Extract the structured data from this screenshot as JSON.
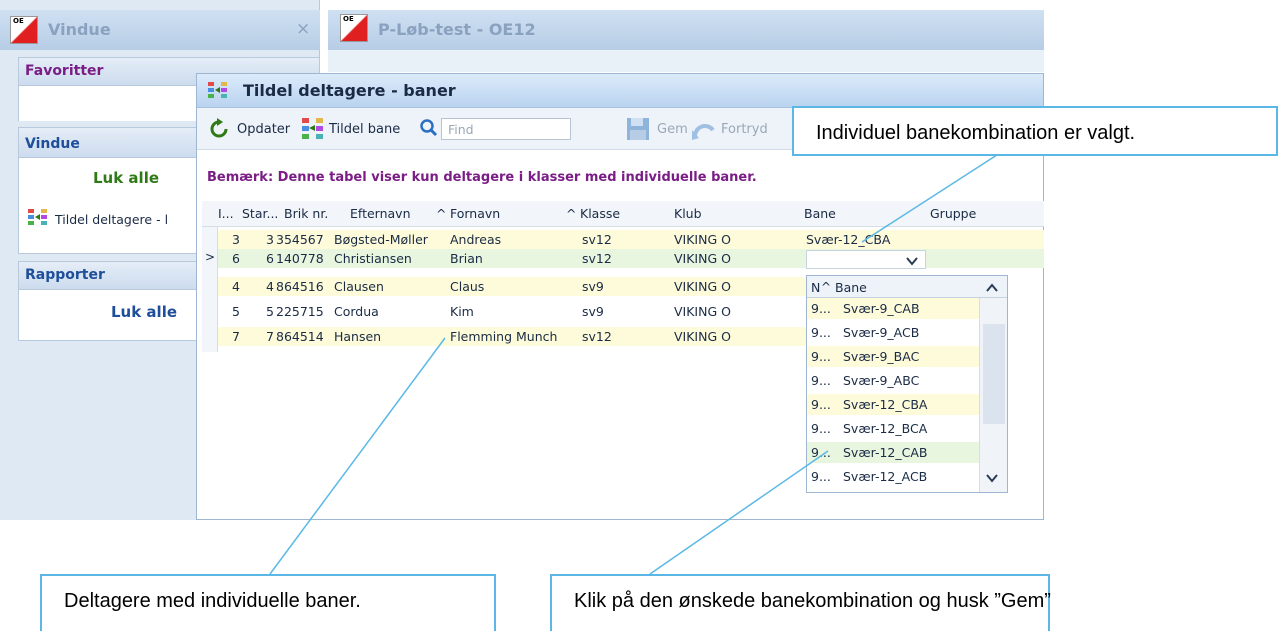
{
  "left_window": {
    "title": "Vindue",
    "close": "×",
    "favorites": {
      "title": "Favoritter"
    },
    "window_group": {
      "title": "Vindue",
      "close_all": "Luk alle",
      "item_label": "Tildel deltagere - l"
    },
    "reports_group": {
      "title": "Rapporter",
      "close_all": "Luk alle"
    },
    "collapse_icon": "^"
  },
  "main_window": {
    "title": "P-Løb-test - OE12"
  },
  "dialog": {
    "title": "Tildel deltagere - baner",
    "toolbar": {
      "refresh_label": "Opdater",
      "assign_label": "Tildel bane",
      "find_placeholder": "Find",
      "save_label": "Gem",
      "undo_label": "Fortryd"
    },
    "notice": "Bemærk: Denne tabel viser kun deltagere i klasser med individuelle baner.",
    "columns": [
      "I...",
      "Star...",
      "Brik nr.",
      "Efternavn",
      "Fornavn",
      "Klasse",
      "Klub",
      "Bane",
      "Gruppe"
    ],
    "sort_indicator": "^",
    "current_row_indicator": ">",
    "rows": [
      {
        "i": "3",
        "start": "3",
        "brik": "354567",
        "efternavn": "Bøgsted-Møller",
        "fornavn": "Andreas",
        "klasse": "sv12",
        "klub": "VIKING O",
        "bane": "Svær-12_CBA",
        "gruppe": ""
      },
      {
        "i": "6",
        "start": "6",
        "brik": "140778",
        "efternavn": "Christiansen",
        "fornavn": "Brian",
        "klasse": "sv12",
        "klub": "VIKING O",
        "bane": "",
        "gruppe": ""
      },
      {
        "i": "4",
        "start": "4",
        "brik": "864516",
        "efternavn": "Clausen",
        "fornavn": "Claus",
        "klasse": "sv9",
        "klub": "VIKING O",
        "bane": "",
        "gruppe": ""
      },
      {
        "i": "5",
        "start": "5",
        "brik": "225715",
        "efternavn": "Cordua",
        "fornavn": "Kim",
        "klasse": "sv9",
        "klub": "VIKING O",
        "bane": "",
        "gruppe": ""
      },
      {
        "i": "7",
        "start": "7",
        "brik": "864514",
        "efternavn": "Hansen",
        "fornavn": "Flemming Munch",
        "klasse": "sv12",
        "klub": "VIKING O",
        "bane": "",
        "gruppe": ""
      }
    ],
    "dropdown": {
      "headers": [
        "N",
        "Bane"
      ],
      "sort_indicator": "^",
      "items": [
        {
          "nr": "9...",
          "bane": "Svær-9_CAB"
        },
        {
          "nr": "9...",
          "bane": "Svær-9_ACB"
        },
        {
          "nr": "9...",
          "bane": "Svær-9_BAC"
        },
        {
          "nr": "9...",
          "bane": "Svær-9_ABC"
        },
        {
          "nr": "9...",
          "bane": "Svær-12_CBA"
        },
        {
          "nr": "9...",
          "bane": "Svær-12_BCA"
        },
        {
          "nr": "9...",
          "bane": "Svær-12_CAB"
        },
        {
          "nr": "9...",
          "bane": "Svær-12_ACB"
        }
      ]
    }
  },
  "callouts": {
    "top": "Individuel banekombination er valgt.",
    "bottom_left": "Deltagere med individuelle baner.",
    "bottom_right": "Klik på den ønskede banekombination og husk ”Gem”"
  },
  "colors": {
    "callout_border": "#5bb8e6",
    "notice_purple": "#7a1e86",
    "luk_green": "#2f7a17",
    "row_yellow": "#fdfbd9",
    "row_green": "#e8f6e0"
  }
}
